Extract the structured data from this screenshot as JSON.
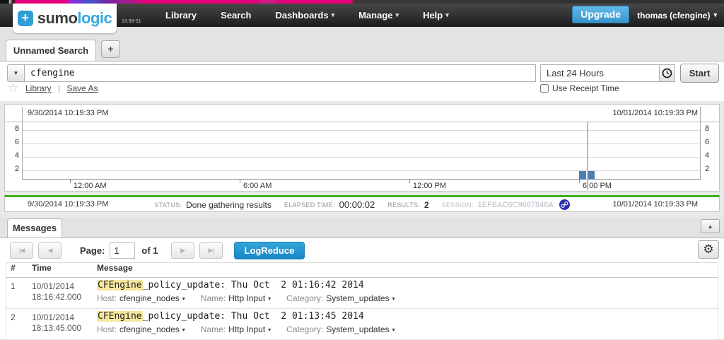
{
  "topnav": {
    "logo_plus": "+",
    "logo_sumo": "sumo",
    "logo_logic": "logic",
    "version": "19.99-51",
    "items": [
      {
        "label": "Library"
      },
      {
        "label": "Search"
      },
      {
        "label": "Dashboards"
      },
      {
        "label": "Manage"
      },
      {
        "label": "Help"
      }
    ],
    "menu_arrow": "▾",
    "upgrade_label": "Upgrade",
    "user_label": "thomas (cfengine)"
  },
  "tabs": {
    "active_label": "Unnamed Search",
    "new_tab_label": "+"
  },
  "search": {
    "query": "cfengine",
    "combo_arrow": "▼",
    "time_range": "Last 24 Hours",
    "start_label": "Start",
    "star_icon": "☆",
    "library_label": "Library",
    "divider": "|",
    "save_as_label": "Save As",
    "use_receipt_label": "Use Receipt Time"
  },
  "chart": {
    "start_time": "9/30/2014 10:19:33 PM",
    "end_time": "10/01/2014 10:19:33 PM",
    "y_labels": [
      "8",
      "6",
      "4",
      "2"
    ],
    "x_ticks": [
      "12:00 AM",
      "6:00 AM",
      "12:00 PM",
      "6:00 PM"
    ]
  },
  "chart_data": {
    "type": "bar",
    "title": "search results message histogram",
    "x_range": [
      "9/30/2014 10:19:33 PM",
      "10/01/2014 10:19:33 PM"
    ],
    "x_tick_labels": [
      "12:00 AM",
      "6:00 AM",
      "12:00 PM",
      "6:00 PM"
    ],
    "y_tick_labels": [
      2,
      4,
      6,
      8
    ],
    "bars": [
      {
        "x": "10/01/2014 ~6:13 PM",
        "value": 1
      },
      {
        "x": "10/01/2014 ~6:16 PM",
        "value": 1
      }
    ],
    "marker_line_x": "10/01/2014 ~6:16 PM",
    "bar_color": "#4d7db3",
    "marker_color": "#f4a0a0",
    "grid": true
  },
  "status": {
    "start_time": "9/30/2014 10:19:33 PM",
    "end_time": "10/01/2014 10:19:33 PM",
    "status_label": "STATUS:",
    "status_value": "Done gathering results",
    "elapsed_label": "ELAPSED TIME:",
    "elapsed_value": "00:00:02",
    "results_label": "RESULTS:",
    "results_value": "2",
    "session_label": "SESSION:",
    "session_value": "1EFBAC6C9667846A",
    "progress_color": "#3fae1c"
  },
  "messages": {
    "tab_label": "Messages",
    "collapse_icon": "▲",
    "first_icon": "|◀",
    "prev_icon": "◀",
    "next_icon": "▶",
    "last_icon": "▶|",
    "page_label": "Page:",
    "page_value": "1",
    "of_label": "of 1",
    "logreduce_label": "LogReduce",
    "gear_icon": "⚙",
    "headers": [
      "#",
      "Time",
      "Message"
    ],
    "dropdown_arrow": "▾",
    "rows": [
      {
        "num": "1",
        "date": "10/01/2014",
        "time": "18:16:42.000",
        "highlight": "CFEngine",
        "message_rest": "_policy_update: Thu Oct  2 01:16:42 2014",
        "host_label": "Host:",
        "host_value": "cfengine_nodes",
        "name_label": "Name:",
        "name_value": "Http Input",
        "category_label": "Category:",
        "category_value": "System_updates"
      },
      {
        "num": "2",
        "date": "10/01/2014",
        "time": "18:13:45.000",
        "highlight": "CFEngine",
        "message_rest": "_policy_update: Thu Oct  2 01:13:45 2014",
        "host_label": "Host:",
        "host_value": "cfengine_nodes",
        "name_label": "Name:",
        "name_value": "Http Input",
        "category_label": "Category:",
        "category_value": "System_updates"
      }
    ]
  }
}
